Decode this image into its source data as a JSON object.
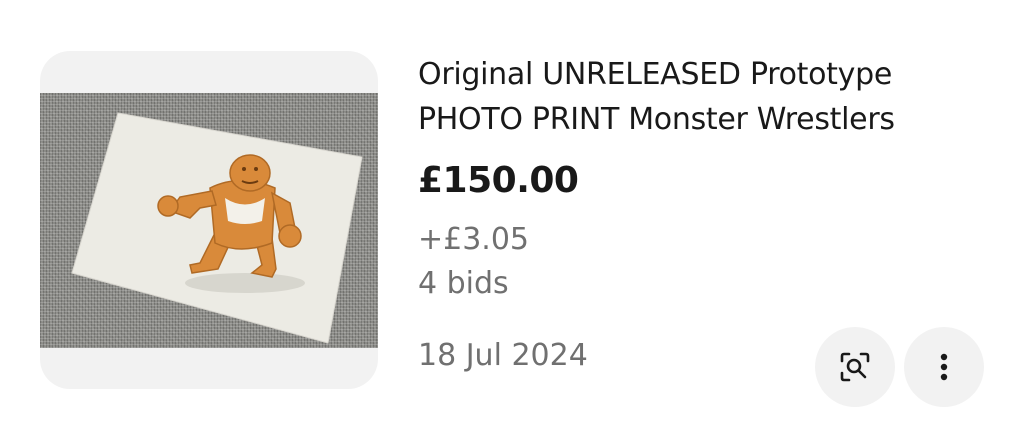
{
  "listing": {
    "title": "Original UNRELEASED Prototype PHOTO PRINT Monster Wrestlers",
    "price": "£150.00",
    "shipping": "+£3.05",
    "bids": "4 bids",
    "date": "18 Jul 2024"
  },
  "icons": {
    "visual_search": "visual-search-icon",
    "more": "more-vertical-icon"
  }
}
